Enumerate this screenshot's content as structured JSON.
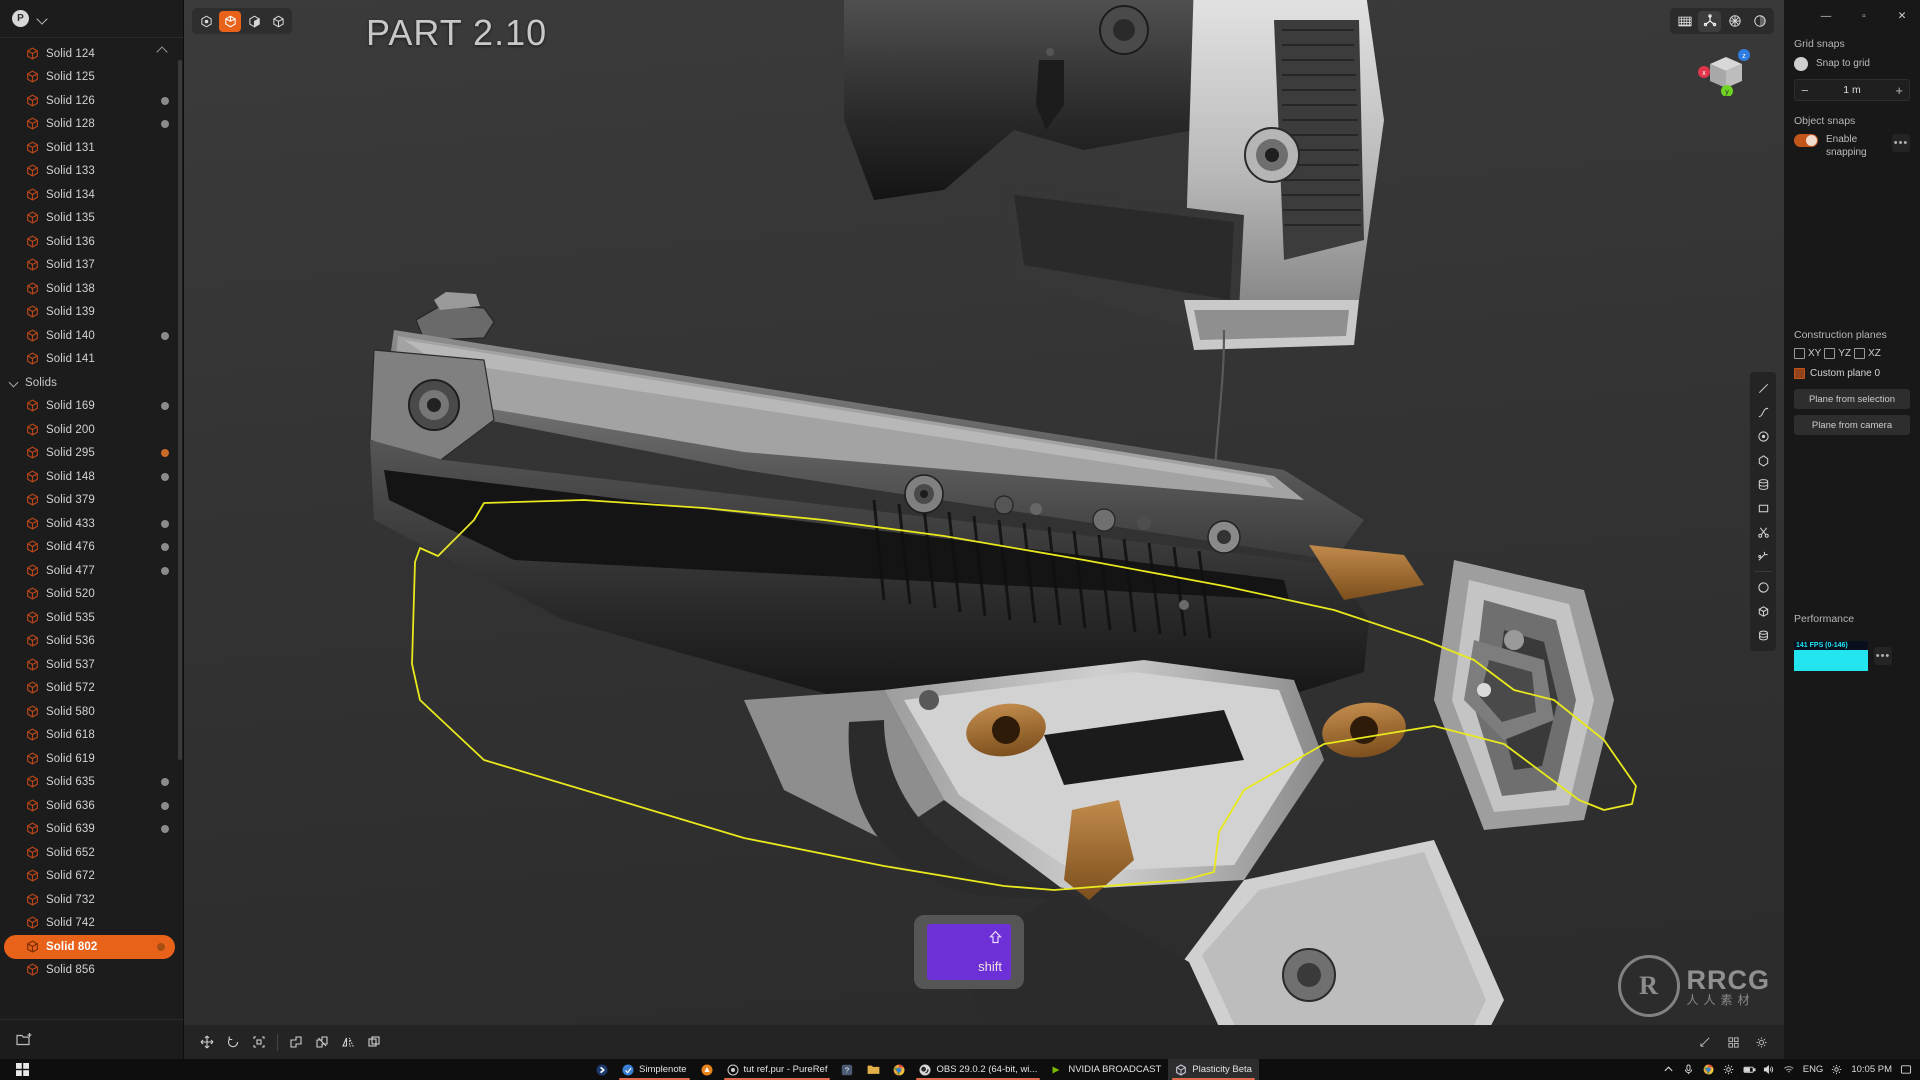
{
  "app": {
    "title": "PART 2.10",
    "logo_letter": "P"
  },
  "sidebar": {
    "groups": [
      {
        "name": "",
        "expanded": true,
        "items": [
          {
            "label": "Solid 124",
            "dot": false
          },
          {
            "label": "Solid 125",
            "dot": false
          },
          {
            "label": "Solid 126",
            "dot": true
          },
          {
            "label": "Solid 128",
            "dot": true
          },
          {
            "label": "Solid 131",
            "dot": false
          },
          {
            "label": "Solid 133",
            "dot": false
          },
          {
            "label": "Solid 134",
            "dot": false
          },
          {
            "label": "Solid 135",
            "dot": false
          },
          {
            "label": "Solid 136",
            "dot": false
          },
          {
            "label": "Solid 137",
            "dot": false
          },
          {
            "label": "Solid 138",
            "dot": false
          },
          {
            "label": "Solid 139",
            "dot": false
          },
          {
            "label": "Solid 140",
            "dot": true
          },
          {
            "label": "Solid 141",
            "dot": false
          }
        ]
      },
      {
        "name": "Solids",
        "expanded": true,
        "items": [
          {
            "label": "Solid 169",
            "dot": true
          },
          {
            "label": "Solid 200",
            "dot": false
          },
          {
            "label": "Solid 295",
            "dot": true,
            "dot_color": "orange"
          },
          {
            "label": "Solid 148",
            "dot": true
          },
          {
            "label": "Solid 379",
            "dot": false
          },
          {
            "label": "Solid 433",
            "dot": true
          },
          {
            "label": "Solid 476",
            "dot": true
          },
          {
            "label": "Solid 477",
            "dot": true
          },
          {
            "label": "Solid 520",
            "dot": false
          },
          {
            "label": "Solid 535",
            "dot": false
          },
          {
            "label": "Solid 536",
            "dot": false
          },
          {
            "label": "Solid 537",
            "dot": false
          },
          {
            "label": "Solid 572",
            "dot": false
          },
          {
            "label": "Solid 580",
            "dot": false
          },
          {
            "label": "Solid 618",
            "dot": false
          },
          {
            "label": "Solid 619",
            "dot": false
          },
          {
            "label": "Solid 635",
            "dot": true
          },
          {
            "label": "Solid 636",
            "dot": true
          },
          {
            "label": "Solid 639",
            "dot": true
          },
          {
            "label": "Solid 652",
            "dot": false
          },
          {
            "label": "Solid 672",
            "dot": false
          },
          {
            "label": "Solid 732",
            "dot": false
          },
          {
            "label": "Solid 742",
            "dot": false
          },
          {
            "label": "Solid 802",
            "dot": true,
            "selected": true
          },
          {
            "label": "Solid 856",
            "dot": false
          }
        ]
      }
    ]
  },
  "viewport": {
    "mode_buttons": [
      {
        "name": "select-point-mode",
        "active": false
      },
      {
        "name": "select-edge-mode",
        "active": true
      },
      {
        "name": "select-face-mode",
        "active": false
      },
      {
        "name": "select-solid-mode",
        "active": false
      }
    ],
    "view_buttons": [
      {
        "name": "grid-toggle",
        "active": false
      },
      {
        "name": "axes-toggle",
        "active": true
      },
      {
        "name": "orientation-toggle",
        "active": false
      },
      {
        "name": "render-mode-toggle",
        "active": false
      }
    ],
    "key_overlay": {
      "label": "shift",
      "color": "#6d2fd6"
    },
    "bottom_tools": [
      "move-tool",
      "rotate-tool",
      "scale-tool",
      "union-tool",
      "cut-tool",
      "mirror-tool",
      "duplicate-tool"
    ],
    "watermark": {
      "letter": "R",
      "main": "RRCG",
      "sub": "人人素材"
    }
  },
  "right_panel": {
    "window_controls": {
      "minimize": "—",
      "maximize": "▫",
      "close": "✕"
    },
    "grid_snaps": {
      "title": "Grid snaps",
      "snap_to_grid_label": "Snap to grid",
      "snap_to_grid_on": false,
      "step_value": "1 m",
      "minus": "−",
      "plus": "+"
    },
    "object_snaps": {
      "title": "Object snaps",
      "enable_label": "Enable snapping",
      "enabled": true,
      "more": "•••"
    },
    "construction_planes": {
      "title": "Construction planes",
      "planes": [
        "XY",
        "YZ",
        "XZ"
      ],
      "custom_plane": "Custom plane 0",
      "buttons": [
        "Plane from selection",
        "Plane from camera"
      ]
    },
    "performance": {
      "title": "Performance",
      "fps_text": "141 FPS (0-146)",
      "graph_color": "#22e5f0"
    }
  },
  "taskbar": {
    "items": [
      {
        "label": "",
        "icon": "bluetooth-icon",
        "active": false,
        "underline": false
      },
      {
        "label": "Simplenote",
        "icon": "simplenote-icon",
        "active": false,
        "underline": true
      },
      {
        "label": "",
        "icon": "drive-icon",
        "active": false,
        "underline": false
      },
      {
        "label": "tut ref.pur - PureRef",
        "icon": "pureref-icon",
        "active": false,
        "underline": true
      },
      {
        "label": "",
        "icon": "help-icon",
        "active": false,
        "underline": false
      },
      {
        "label": "",
        "icon": "folder-icon",
        "active": false,
        "underline": false
      },
      {
        "label": "",
        "icon": "chrome-icon",
        "active": false,
        "underline": false
      },
      {
        "label": "OBS 29.0.2 (64-bit, wi...",
        "icon": "obs-icon",
        "active": false,
        "underline": true
      },
      {
        "label": "NVIDIA BROADCAST",
        "icon": "nvidia-icon",
        "active": false,
        "underline": false
      },
      {
        "label": "Plasticity Beta",
        "icon": "plasticity-icon",
        "active": true,
        "underline": true
      }
    ],
    "tray": {
      "language": "ENG",
      "time": "10:05 PM"
    }
  }
}
